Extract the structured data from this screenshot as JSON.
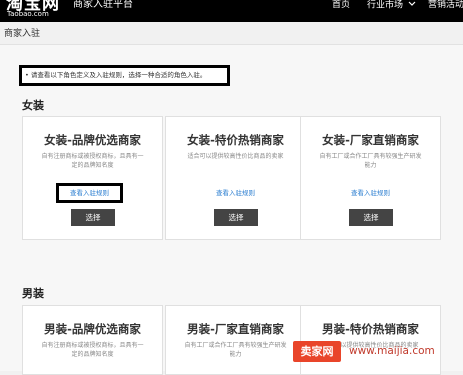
{
  "header": {
    "logo_text": "淘宝网",
    "logo_sub": "Taobao.com",
    "portal_title": "商家入驻平台",
    "nav": [
      "首页",
      "行业市场",
      "营销活动"
    ],
    "nav_dropdown_icon": "chevron-down-icon"
  },
  "breadcrumb": "商家入驻",
  "notice": "• 请查看以下角色定义及入驻规则，选择一种合适的角色入驻。",
  "sections": [
    {
      "title": "女装",
      "cards": [
        {
          "title": "女装-品牌优选商家",
          "desc": "自有注册商标或被授权商标，且具有一定的品牌知名度",
          "rule_link": "查看入驻规则",
          "select": "选择"
        },
        {
          "title": "女装-特价热销商家",
          "desc": "适合可以提供较高性价比商品的卖家",
          "rule_link": "查看入驻规则",
          "select": "选择"
        },
        {
          "title": "女装-厂家直销商家",
          "desc": "自有工厂或合作工厂具有较强生产研发能力",
          "rule_link": "查看入驻规则",
          "select": "选择"
        }
      ]
    },
    {
      "title": "男装",
      "cards": [
        {
          "title": "男装-品牌优选商家",
          "desc": "自有注册商标或被授权商标，且具有一定的品牌知名度"
        },
        {
          "title": "男装-厂家直销商家",
          "desc": "自有工厂或合作工厂具有较强生产研发能力"
        },
        {
          "title": "男装-特价热销商家",
          "desc": "适合可以提供较高性价比商品的卖家"
        }
      ]
    }
  ],
  "watermark": {
    "badge": "卖家网",
    "url": "www.maijia.com"
  }
}
